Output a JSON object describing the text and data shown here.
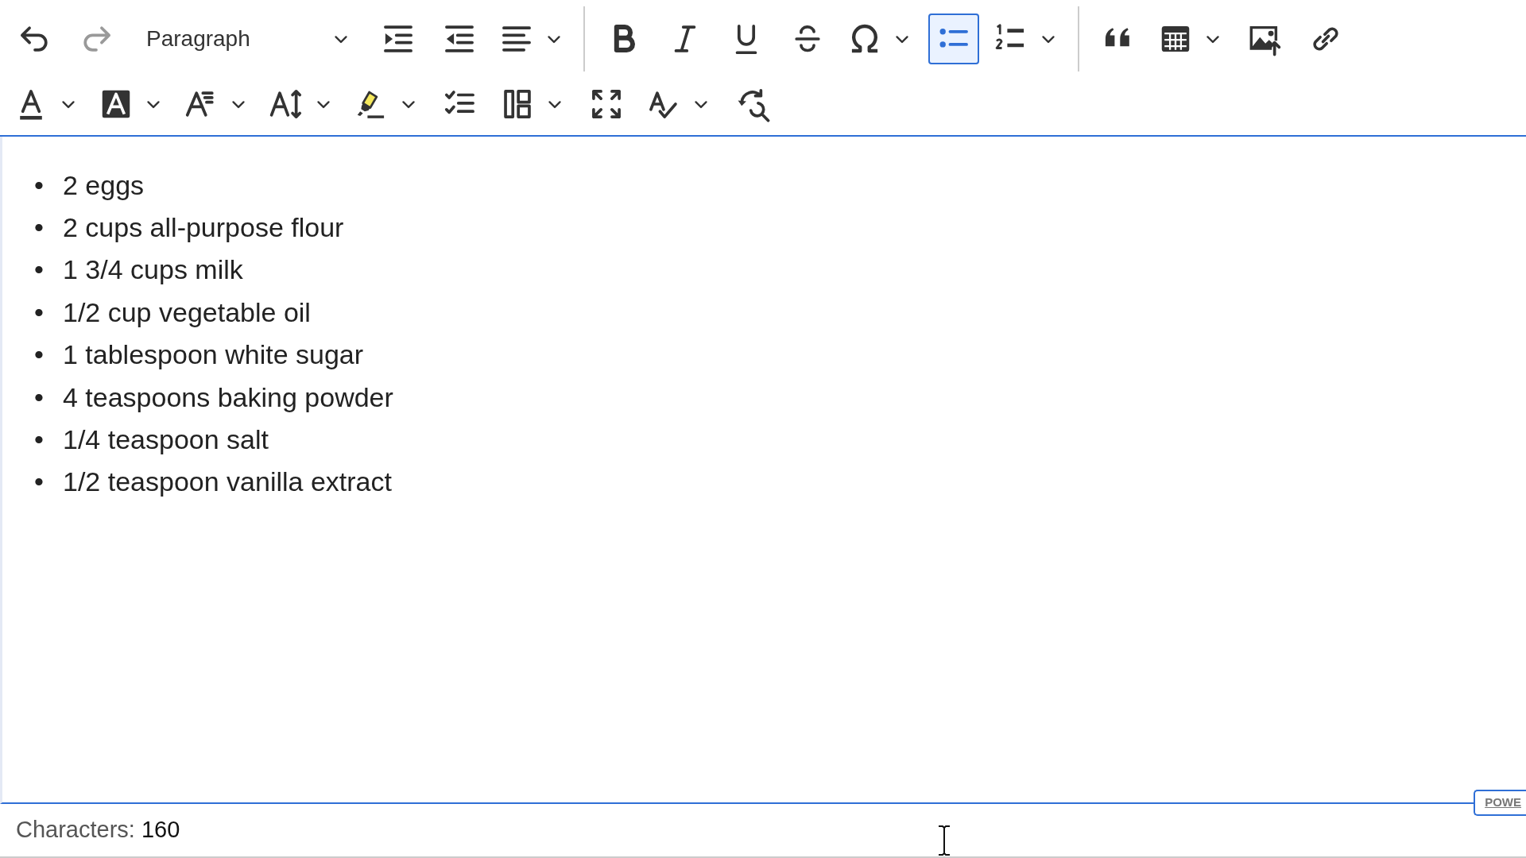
{
  "toolbar": {
    "rows": [
      {
        "items": [
          {
            "kind": "button",
            "selected": false,
            "disabled": false
          },
          {
            "kind": "button",
            "selected": false,
            "disabled": true
          },
          {
            "kind": "select",
            "label": "Paragraph"
          },
          {
            "kind": "button",
            "selected": false,
            "disabled": false
          },
          {
            "kind": "button",
            "selected": false,
            "disabled": false
          },
          {
            "kind": "split",
            "selected": false,
            "disabled": false
          },
          {
            "kind": "separator"
          },
          {
            "kind": "button",
            "selected": false,
            "disabled": false
          },
          {
            "kind": "button",
            "selected": false,
            "disabled": false
          },
          {
            "kind": "button",
            "selected": false,
            "disabled": false
          },
          {
            "kind": "button",
            "selected": false,
            "disabled": false
          },
          {
            "kind": "split",
            "selected": false,
            "disabled": false
          },
          {
            "kind": "button",
            "selected": true,
            "disabled": false
          },
          {
            "kind": "split",
            "selected": false,
            "disabled": false
          },
          {
            "kind": "separator"
          },
          {
            "kind": "button",
            "selected": false,
            "disabled": false
          },
          {
            "kind": "split",
            "selected": false,
            "disabled": false
          },
          {
            "kind": "button",
            "selected": false,
            "disabled": false
          },
          {
            "kind": "button",
            "selected": false,
            "disabled": false
          }
        ]
      },
      {
        "items": [
          {
            "kind": "split",
            "selected": false,
            "disabled": false
          },
          {
            "kind": "split",
            "selected": false,
            "disabled": false
          },
          {
            "kind": "split",
            "selected": false,
            "disabled": false
          },
          {
            "kind": "split",
            "selected": false,
            "disabled": false
          },
          {
            "kind": "split",
            "selected": false,
            "disabled": false
          },
          {
            "kind": "button",
            "selected": false,
            "disabled": false
          },
          {
            "kind": "split",
            "selected": false,
            "disabled": false
          },
          {
            "kind": "button",
            "selected": false,
            "disabled": false
          },
          {
            "kind": "split",
            "selected": false,
            "disabled": false
          },
          {
            "kind": "button",
            "selected": false,
            "disabled": false
          }
        ]
      }
    ]
  },
  "editor": {
    "items": [
      {
        "marker": "•",
        "text": "2 eggs"
      },
      {
        "marker": "•",
        "text": "2 cups all-purpose flour"
      },
      {
        "marker": "•",
        "text": "1 3/4 cups milk"
      },
      {
        "marker": "•",
        "text": "1/2 cup vegetable oil"
      },
      {
        "marker": "•",
        "text": "1 tablespoon white sugar"
      },
      {
        "marker": "•",
        "text": "4 teaspoons baking powder"
      },
      {
        "marker": "•",
        "text": "1/4 teaspoon salt"
      },
      {
        "marker": "•",
        "text": "1/2 teaspoon vanilla extract"
      }
    ]
  },
  "word_count": {
    "label": "Characters:",
    "value": "160"
  },
  "powered_badge": "POWE"
}
